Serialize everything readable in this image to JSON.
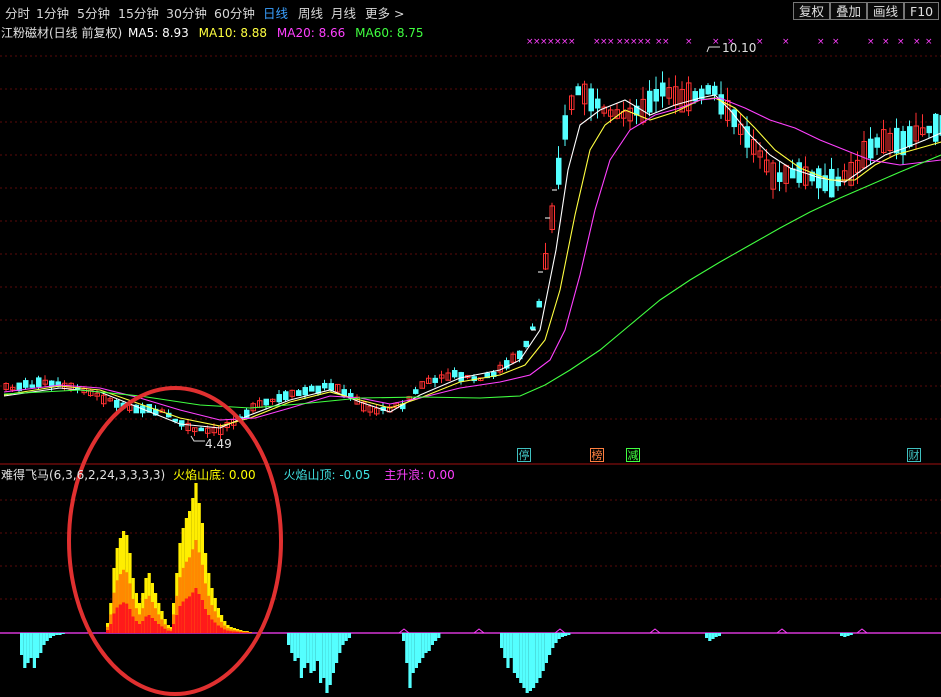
{
  "toolbar": {
    "periods": [
      "分时",
      "1分钟",
      "5分钟",
      "15分钟",
      "30分钟",
      "60分钟",
      "日线",
      "周线",
      "月线",
      "更多 >"
    ],
    "active_period": "日线",
    "buttons": [
      "复权",
      "叠加",
      "画线",
      "F10"
    ]
  },
  "main_chart": {
    "title": "江粉磁材(日线 前复权)",
    "ma_legend": [
      {
        "label": "MA5: 8.93",
        "color": "#ffffff"
      },
      {
        "label": "MA10: 8.88",
        "color": "#ffff40"
      },
      {
        "label": "MA20: 8.66",
        "color": "#ff40ff"
      },
      {
        "label": "MA60: 8.75",
        "color": "#40ff40"
      }
    ],
    "high_label": "10.10",
    "low_label": "4.49",
    "signal_tags": [
      {
        "text": "停",
        "color": "#40c0c0"
      },
      {
        "text": "榜",
        "color": "#ff8040"
      },
      {
        "text": "减",
        "color": "#40ff40"
      },
      {
        "text": "财",
        "color": "#40c0c0"
      }
    ]
  },
  "indicator": {
    "title": "难得飞马(6,3,6,2,24,3,3,3,3)",
    "values": [
      {
        "label": "火焰山底: 0.00",
        "color": "#ffff00"
      },
      {
        "label": "火焰山顶: -0.05",
        "color": "#40e0e0"
      },
      {
        "label": "主升浪: 0.00",
        "color": "#ff40ff"
      }
    ]
  },
  "colors": {
    "up": "#ff3232",
    "down": "#54ffff",
    "ma5": "#ffffff",
    "ma10": "#ffff40",
    "ma20": "#ff40ff",
    "ma60": "#40ff40",
    "flame_yellow": "#ffee00",
    "flame_orange": "#ff8800",
    "flame_red": "#ff1a1a",
    "annotation_circle": "#e03030"
  }
}
